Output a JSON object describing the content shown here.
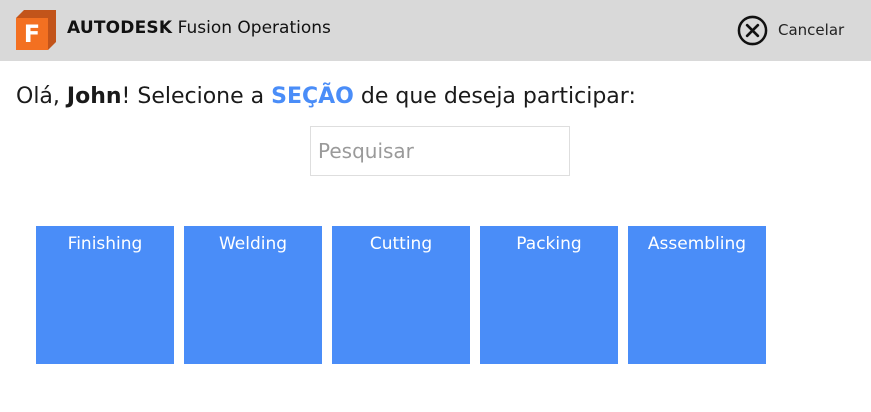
{
  "header": {
    "brand_bold": "AUTODESK",
    "brand_rest": "Fusion Operations",
    "logo_letter": "F",
    "cancel_label": "Cancelar",
    "logo_colors": {
      "front": "#f37021",
      "back": "#c2541a"
    }
  },
  "greeting": {
    "hello": "Olá,",
    "name": "John",
    "exclaim": "!",
    "prefix": "Selecione a",
    "keyword": "SEÇÃO",
    "suffix": "de que deseja participar:"
  },
  "search": {
    "placeholder": "Pesquisar",
    "value": ""
  },
  "sections": [
    {
      "label": "Finishing"
    },
    {
      "label": "Welding"
    },
    {
      "label": "Cutting"
    },
    {
      "label": "Packing"
    },
    {
      "label": "Assembling"
    }
  ],
  "colors": {
    "accent": "#4a8df8",
    "header_bg": "#d9d9d9"
  }
}
